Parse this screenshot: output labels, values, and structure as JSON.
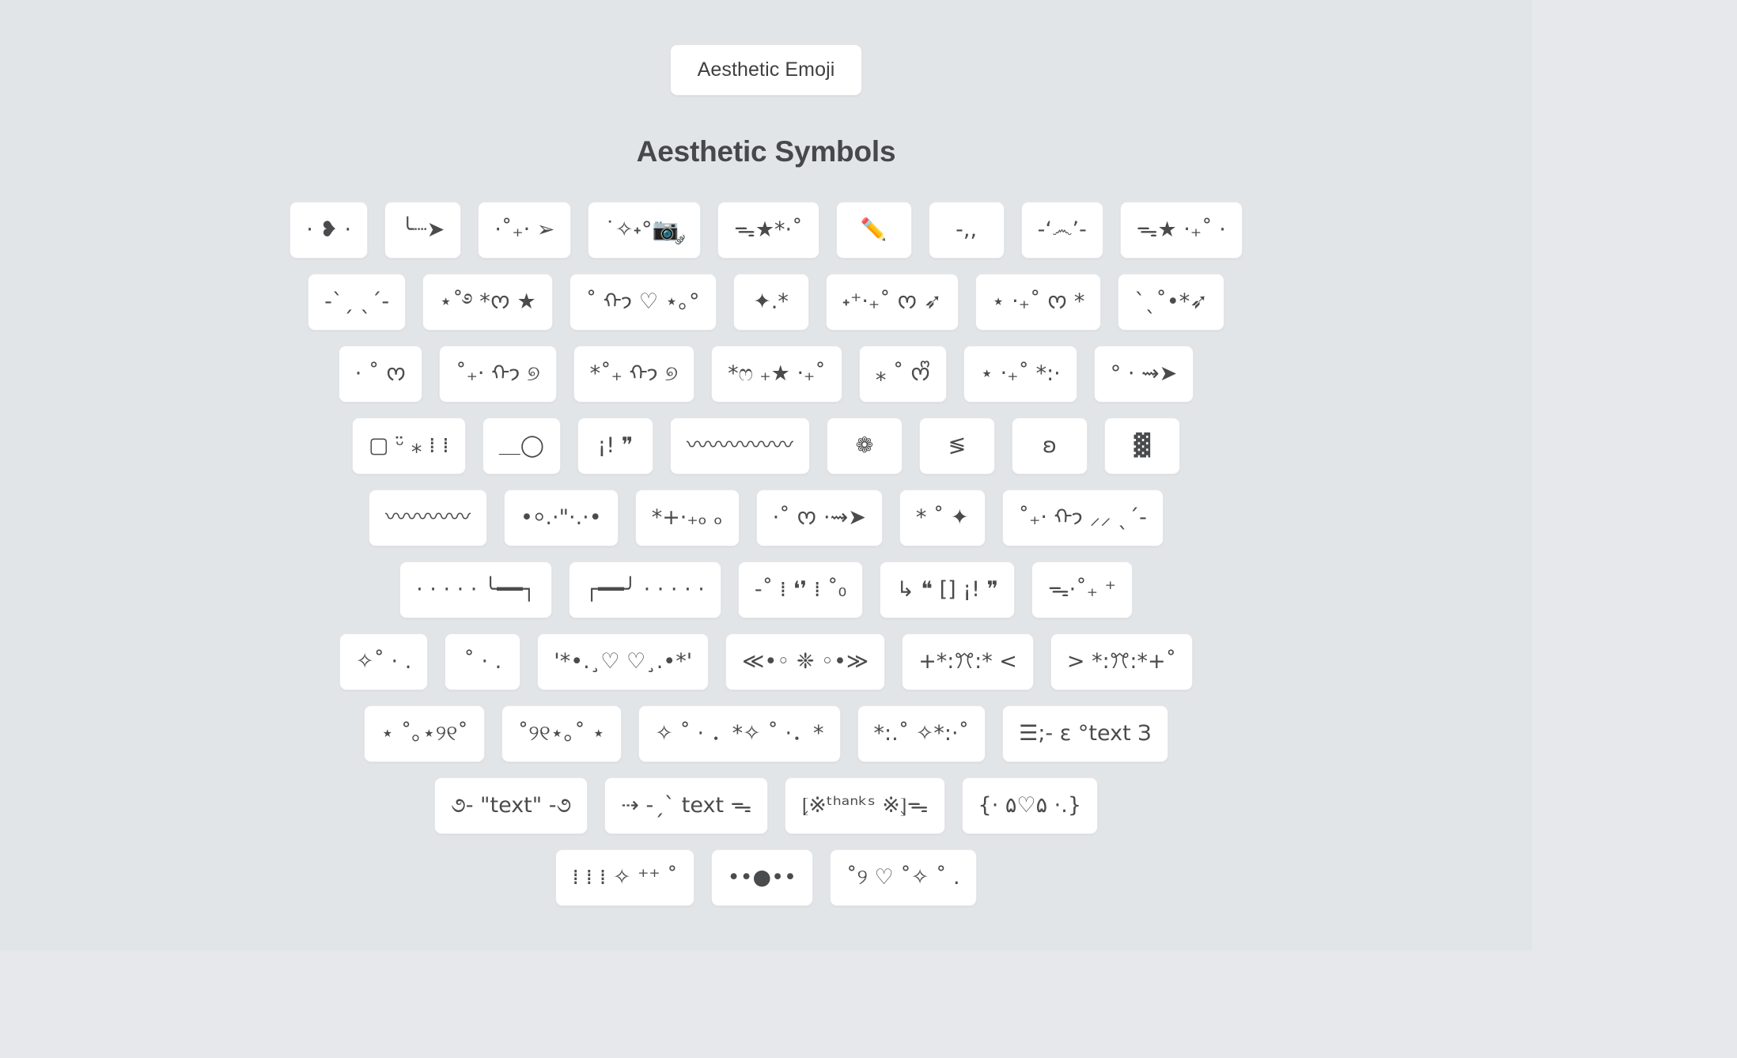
{
  "header": {
    "tag_label": "Aesthetic Emoji"
  },
  "section": {
    "title": "Aesthetic Symbols"
  },
  "theme": {
    "page_background": "#e6e8eb",
    "panel_background": "#e2e5e8",
    "card_background": "#ffffff",
    "card_border": "#e6e7e9",
    "text_color": "#3f4042",
    "symbol_color": "#4a4b4d"
  },
  "symbol_rows": [
    {
      "row": 1,
      "cards": [
        {
          "symbol": "· ❥ ·"
        },
        {
          "symbol": "╰┈➤"
        },
        {
          "symbol": "⋅˚₊‧ ➢"
        },
        {
          "symbol": "˙✧˖°📷 ༘"
        },
        {
          "symbol": "ᯓ★*·˚"
        },
        {
          "symbol": "✏️"
        },
        {
          "symbol": "-,,"
        },
        {
          "symbol": "-‘෴’-"
        },
        {
          "symbol": "ᯓ★ ‧₊˚ ·"
        }
      ]
    },
    {
      "row": 2,
      "cards": [
        {
          "symbol": "-ˋˏ ˎˊ-"
        },
        {
          "symbol": "⋆˚࿔ *ᰔ ★"
        },
        {
          "symbol": "˚ ᡣ𐭩 ♡ ⋆｡°"
        },
        {
          "symbol": "✦.*"
        },
        {
          "symbol": "˖⁺‧₊˚ ᰔ ➶"
        },
        {
          "symbol": "⋆ ‧₊˚ ᰔ *"
        },
        {
          "symbol": "ˋˎ˚•*➶"
        }
      ]
    },
    {
      "row": 3,
      "cards": [
        {
          "symbol": "· ˚ ᰔ"
        },
        {
          "symbol": "˚₊‧ ᡣ𐭩 ୭"
        },
        {
          "symbol": "*˚₊ ᡣ𐭩 ୭"
        },
        {
          "symbol": "*ෆ ₊★ ‧₊˚"
        },
        {
          "symbol": "⁎ ˚ ᰔᩚ"
        },
        {
          "symbol": "⋆ ‧₊˚ *:·"
        },
        {
          "symbol": "° ⋅ ⇝➤"
        }
      ]
    },
    {
      "row": 4,
      "cards": [
        {
          "symbol": "▢ ᵕ̈ ⁎ ⁞ ⁞"
        },
        {
          "symbol": "＿◯"
        },
        {
          "symbol": "¡! ❞"
        },
        {
          "symbol": "〰〰〰〰〰"
        },
        {
          "symbol": "❁"
        },
        {
          "symbol": "≶"
        },
        {
          "symbol": "ʚ"
        },
        {
          "symbol": "▓"
        }
      ]
    },
    {
      "row": 5,
      "cards": [
        {
          "symbol": "〰〰〰〰"
        },
        {
          "symbol": "•⸰.·\"·.·•"
        },
        {
          "symbol": "*+·₊ₒ ₒ"
        },
        {
          "symbol": "·˚ ᰔ ·⇝➤"
        },
        {
          "symbol": "* ˚ ✦"
        },
        {
          "symbol": "˚₊‧ ᡣ𐭩 ⸝⸝ ˎˊ-"
        }
      ]
    },
    {
      "row": 6,
      "cards": [
        {
          "symbol": "· · · · ·   ╰━━┐"
        },
        {
          "symbol": "┌━━╯   · · · · ·"
        },
        {
          "symbol": "-˚ ⁞ ❛❜ ⁞ ˚₀"
        },
        {
          "symbol": "↳ ❝ [] ¡! ❞"
        },
        {
          "symbol": "ᯓ·˚₊ ⁺"
        }
      ]
    },
    {
      "row": 7,
      "cards": [
        {
          "symbol": "✧˚ · ."
        },
        {
          "symbol": "˚ · ."
        },
        {
          "symbol": "'*•.¸♡ ♡¸.•*'"
        },
        {
          "symbol": "≪•◦ ❈ ◦•≫"
        },
        {
          "symbol": "+*:ꔫ:* <"
        },
        {
          "symbol": "> *:ꔫ:*+˚"
        }
      ]
    },
    {
      "row": 8,
      "cards": [
        {
          "symbol": "⋆ ˚｡⋆୨୧˚"
        },
        {
          "symbol": "˚୨୧⋆｡˚ ⋆"
        },
        {
          "symbol": "✧ ˚ · ．*✧ ˚ ·．*"
        },
        {
          "symbol": "*:.˚ ✧*:·˚"
        },
        {
          "symbol": "☰;- ɛ °text З"
        }
      ]
    },
    {
      "row": 9,
      "cards": [
        {
          "symbol": "૭- \"text\" -૭"
        },
        {
          "symbol": "⇢ -ˏ` text ᯓ"
        },
        {
          "symbol": "⦏※ᵗʰᵃⁿᵏˢ ※⦎ᯓ"
        },
        {
          "symbol": "{·  ۵♡۵  ·.}"
        }
      ]
    },
    {
      "row": 10,
      "cards": [
        {
          "symbol": "⁞ ⁞ ⁞ ✧ ⁺⁺    ˚"
        },
        {
          "symbol": "••●••"
        },
        {
          "symbol": "˚୨ ♡ ˚✧ ˚ ."
        }
      ]
    }
  ]
}
